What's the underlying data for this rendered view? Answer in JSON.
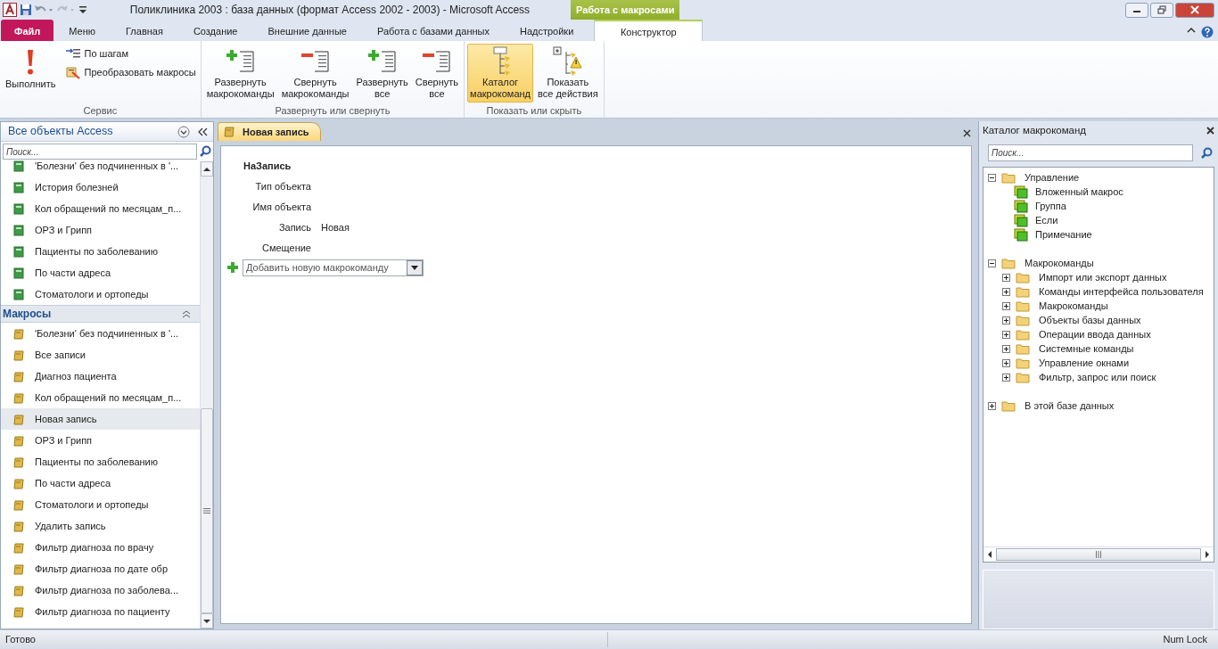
{
  "window": {
    "title": "Поликлиника 2003 : база данных (формат Access 2002 - 2003)  -  Microsoft Access",
    "context_group": "Работа с макросами"
  },
  "ribbon_tabs": [
    {
      "label": "Файл",
      "kind": "file",
      "selected": false
    },
    {
      "label": "Меню",
      "kind": "normal",
      "selected": false
    },
    {
      "label": "Главная",
      "kind": "normal",
      "selected": false
    },
    {
      "label": "Создание",
      "kind": "normal",
      "selected": false
    },
    {
      "label": "Внешние данные",
      "kind": "normal",
      "selected": false
    },
    {
      "label": "Работа с базами данных",
      "kind": "normal",
      "selected": false
    },
    {
      "label": "Надстройки",
      "kind": "normal",
      "selected": false
    },
    {
      "label": "Конструктор",
      "kind": "context",
      "selected": true
    }
  ],
  "ribbon_groups": [
    {
      "label": "Сервис",
      "buttons": [
        {
          "label": "Выполнить",
          "kind": "run",
          "selected": false
        },
        {
          "label": "По шагам",
          "kind": "step",
          "selected": false
        },
        {
          "label": "Преобразовать макросы",
          "kind": "convert",
          "selected": false
        }
      ]
    },
    {
      "label": "Развернуть или свернуть",
      "buttons": [
        {
          "label": "Развернуть\nмакрокоманды",
          "kind": "expand",
          "selected": false
        },
        {
          "label": "Свернуть\nмакрокоманды",
          "kind": "collapse",
          "selected": false
        },
        {
          "label": "Развернуть\nвсе",
          "kind": "expand",
          "selected": false
        },
        {
          "label": "Свернуть\nвсе",
          "kind": "collapse",
          "selected": false
        }
      ]
    },
    {
      "label": "Показать или скрыть",
      "buttons": [
        {
          "label": "Каталог\nмакрокоманд",
          "kind": "catalog",
          "selected": true
        },
        {
          "label": "Показать\nвсе действия",
          "kind": "showall",
          "selected": false
        }
      ]
    }
  ],
  "nav_pane": {
    "title": "Все объекты Access",
    "search": {
      "placeholder": "Поиск..."
    },
    "sections": [
      {
        "items": [
          {
            "label": "'Болезни' без подчиненных в '...",
            "kind": "query",
            "selected": false
          },
          {
            "label": "История болезней",
            "kind": "query",
            "selected": false
          },
          {
            "label": "Кол обращений по месяцам_п...",
            "kind": "query",
            "selected": false
          },
          {
            "label": "ОРЗ и Грипп",
            "kind": "query",
            "selected": false
          },
          {
            "label": "Пациенты по  заболеванию",
            "kind": "query",
            "selected": false
          },
          {
            "label": "По части адреса",
            "kind": "query",
            "selected": false
          },
          {
            "label": "Стоматологи и ортопеды",
            "kind": "query",
            "selected": false
          }
        ]
      },
      {
        "title": "Макросы",
        "items": [
          {
            "label": "'Болезни' без подчиненных в '...",
            "kind": "macro",
            "selected": false
          },
          {
            "label": "Все записи",
            "kind": "macro",
            "selected": false
          },
          {
            "label": "Диагноз пациента",
            "kind": "macro",
            "selected": false
          },
          {
            "label": "Кол обращений по месяцам_п...",
            "kind": "macro",
            "selected": false
          },
          {
            "label": "Новая запись",
            "kind": "macro",
            "selected": true
          },
          {
            "label": "ОРЗ и Грипп",
            "kind": "macro",
            "selected": false
          },
          {
            "label": "Пациенты по заболеванию",
            "kind": "macro",
            "selected": false
          },
          {
            "label": "По части адреса",
            "kind": "macro",
            "selected": false
          },
          {
            "label": "Стоматологи и ортопеды",
            "kind": "macro",
            "selected": false
          },
          {
            "label": "Удалить запись",
            "kind": "macro",
            "selected": false
          },
          {
            "label": "Фильтр диагноза по врачу",
            "kind": "macro",
            "selected": false
          },
          {
            "label": "Фильтр диагноза по дате обр",
            "kind": "macro",
            "selected": false
          },
          {
            "label": "Фильтр диагноза по заболева...",
            "kind": "macro",
            "selected": false
          },
          {
            "label": "Фильтр диагноза по пациенту",
            "kind": "macro",
            "selected": false
          }
        ]
      }
    ]
  },
  "document_tab": {
    "label": "Новая запись"
  },
  "macro": {
    "action": "НаЗапись",
    "arguments": [
      {
        "label": "Тип объекта"
      },
      {
        "label": "Имя объекта"
      },
      {
        "label": "Запись",
        "value": "Новая"
      },
      {
        "label": "Смещение"
      }
    ],
    "add_action": {
      "value": "Добавить новую макрокоманду"
    }
  },
  "catalog": {
    "title": "Каталог макрокоманд",
    "search": {
      "placeholder": "Поиск..."
    },
    "tree": [
      {
        "label": "Управление",
        "kind": "folder",
        "expanded": true,
        "children": [
          {
            "label": "Вложенный макрос",
            "kind": "action"
          },
          {
            "label": "Группа",
            "kind": "action"
          },
          {
            "label": "Если",
            "kind": "action"
          },
          {
            "label": "Примечание",
            "kind": "action"
          }
        ]
      },
      {
        "label": "Макрокоманды",
        "kind": "folder",
        "expanded": true,
        "children": [
          {
            "label": "Импорт или экспорт данных",
            "kind": "folder",
            "expanded": false
          },
          {
            "label": "Команды интерфейса пользователя",
            "kind": "folder",
            "expanded": false
          },
          {
            "label": "Макрокоманды",
            "kind": "folder",
            "expanded": false
          },
          {
            "label": "Объекты базы данных",
            "kind": "folder",
            "expanded": false
          },
          {
            "label": "Операции ввода данных",
            "kind": "folder",
            "expanded": false
          },
          {
            "label": "Системные команды",
            "kind": "folder",
            "expanded": false
          },
          {
            "label": "Управление окнами",
            "kind": "folder",
            "expanded": false
          },
          {
            "label": "Фильтр, запрос или поиск",
            "kind": "folder",
            "expanded": false
          }
        ]
      },
      {
        "label": "В этой базе данных",
        "kind": "folder",
        "expanded": false
      }
    ]
  },
  "status_bar": {
    "left": "Готово",
    "right": "Num Lock"
  }
}
